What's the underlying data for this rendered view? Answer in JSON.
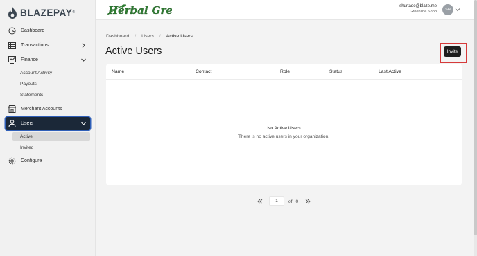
{
  "brand": {
    "name": "BLAZEPAY",
    "reg": "®"
  },
  "logo": {
    "text": "Herbal Greens"
  },
  "sidebar": {
    "items": [
      {
        "label": "Dashboard",
        "icon": "dashboard-icon"
      },
      {
        "label": "Transactions",
        "icon": "table-icon"
      },
      {
        "label": "Finance",
        "icon": "finance-icon"
      },
      {
        "label": "Merchant Accounts",
        "icon": "store-icon"
      },
      {
        "label": "Users",
        "icon": "user-icon"
      },
      {
        "label": "Configure",
        "icon": "gear-icon"
      }
    ],
    "finance_sub": [
      "Account Activity",
      "Payouts",
      "Statements"
    ],
    "users_sub": [
      "Active",
      "Invited"
    ]
  },
  "header": {
    "email": "shurtado@blaze.me",
    "shop": "Greenline Shop",
    "initials": "SH"
  },
  "breadcrumb": [
    "Dashboard",
    "Users",
    "Active Users"
  ],
  "page": {
    "title": "Active Users",
    "invite_label": "Invite"
  },
  "table": {
    "columns": [
      "Name",
      "Contact",
      "Role",
      "Status",
      "Last Active"
    ],
    "empty_title": "No Active Users",
    "empty_desc": "There is no active users in your organization."
  },
  "pagination": {
    "current": "1",
    "of_label": "of",
    "total": "0"
  },
  "colors": {
    "active_nav": "#1b2838",
    "invite_btn": "#1e1e1e",
    "highlight": "#d63a3a",
    "logo_green": "#2f7d32"
  }
}
